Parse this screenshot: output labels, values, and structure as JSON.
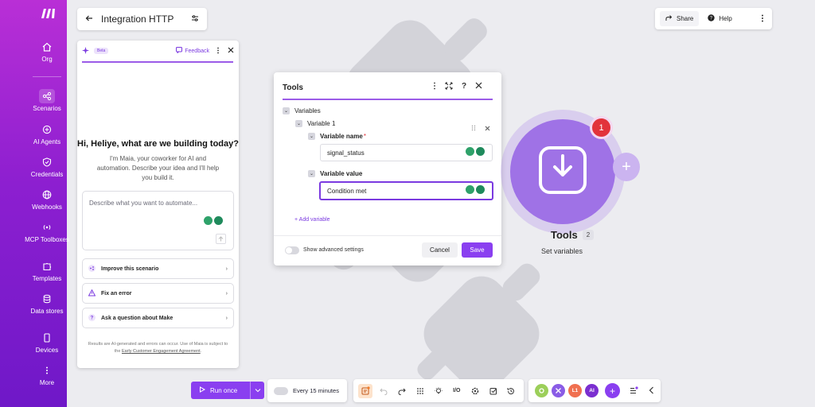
{
  "nav": {
    "items": [
      {
        "label": "Org"
      },
      {
        "label": "Scenarios"
      },
      {
        "label": "AI Agents"
      },
      {
        "label": "Credentials"
      },
      {
        "label": "Webhooks"
      },
      {
        "label": "MCP Toolboxes"
      },
      {
        "label": "Templates"
      },
      {
        "label": "Data stores"
      },
      {
        "label": "Devices"
      },
      {
        "label": "More"
      }
    ]
  },
  "header": {
    "title": "Integration HTTP"
  },
  "topright": {
    "share": "Share",
    "help": "Help"
  },
  "maia": {
    "beta": "Beta",
    "feedback": "Feedback",
    "greeting": "Hi, Heliye, what are we building today?",
    "intro": "I'm Maia, your coworker for AI and automation. Describe your idea and I'll help you build it.",
    "placeholder": "Describe what you want to automate...",
    "suggestions": [
      {
        "label": "Improve this scenario"
      },
      {
        "label": "Fix an error"
      },
      {
        "label": "Ask a question about Make"
      }
    ],
    "disclaimer_pre": "Results are AI-generated and errors can occur. Use of Maia is subject to the ",
    "disclaimer_link": "Early Customer Engagement Agreement",
    "disclaimer_post": "."
  },
  "dialog": {
    "title": "Tools",
    "variables": "Variables",
    "variable1": "Variable 1",
    "name_label": "Variable name",
    "name_value": "signal_status",
    "value_label": "Variable value",
    "value_value": "Condition met",
    "add_variable": "+ Add variable",
    "advanced": "Show advanced settings",
    "cancel": "Cancel",
    "save": "Save"
  },
  "module": {
    "badge": "1",
    "name": "Tools",
    "count": "2",
    "subtitle": "Set variables"
  },
  "bottom": {
    "run": "Run once",
    "schedule": "Every 15 minutes",
    "io": "I/O",
    "apps": [
      {
        "label": "",
        "color": "#9ccf5a"
      },
      {
        "label": "",
        "color": "#8a5ce6"
      },
      {
        "label": "L1",
        "color": "#f07050"
      },
      {
        "label": "AI",
        "color": "#7b2fd0"
      }
    ]
  }
}
